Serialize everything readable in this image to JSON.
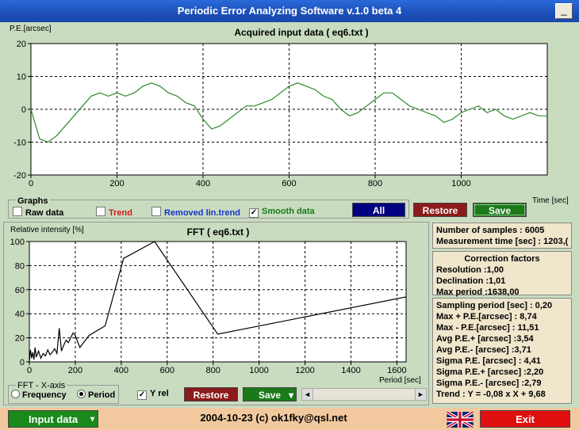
{
  "window": {
    "title": "Periodic Error Analyzing Software v.1.0 beta 4",
    "minimize_glyph": "_"
  },
  "top_chart": {
    "title": "Acquired input data ( eq6.txt )",
    "ylabel": "P.E.[arcsec]",
    "xlabel": "Time [sec]",
    "x_ticks": [
      "0",
      "200",
      "400",
      "600",
      "800",
      "1000"
    ],
    "y_ticks": [
      "20",
      "10",
      "0",
      "-10",
      "-20"
    ]
  },
  "graphs": {
    "legend": "Graphs",
    "raw": "Raw data",
    "trend": "Trend",
    "removed": "Removed lin.trend",
    "smooth": "Smooth data",
    "check_glyph": "✓",
    "all_btn": "All",
    "restore_btn": "Restore",
    "save_btn": "Save"
  },
  "fft_chart": {
    "title": "FFT ( eq6.txt )",
    "ylabel": "Relative intensity [%]",
    "xlabel": "Period [sec]",
    "x_ticks": [
      "0",
      "200",
      "400",
      "600",
      "800",
      "1000",
      "1200",
      "1400",
      "1600"
    ],
    "y_ticks": [
      "100",
      "80",
      "60",
      "40",
      "20",
      "0"
    ]
  },
  "fft_controls": {
    "legend": "FFT - X-axis",
    "frequency": "Frequency",
    "period": "Period",
    "yrel": "Y rel",
    "check_glyph": "✓",
    "restore_btn": "Restore",
    "save_btn": "Save",
    "scroll_left": "◄",
    "scroll_right": "►",
    "dropdown": "▾"
  },
  "info_samples": {
    "line1": "Number of samples : 6005",
    "line2": "Measurement time [sec] : 1203,("
  },
  "correction": {
    "title": "Correction factors",
    "resolution": "Resolution :1,00",
    "declination": "Declination :1,01",
    "max_period": "Max period :1638,00"
  },
  "stats": [
    "Sampling period [sec] : 0,20",
    "Max + P.E.[arcsec] : 8,74",
    "Max - P.E.[arcsec] : 11,51",
    "Avg P.E.+ [arcsec] :3,54",
    "Avg P.E.- [arcsec] :3,71",
    "Sigma P.E. [arcsec] : 4,41",
    "Sigma P.E.+ [arcsec] :2,20",
    "Sigma P.E.- [arcsec] :2,79",
    "Trend : Y = -0,08 x X + 9,68"
  ],
  "bottom": {
    "input_btn": "Input data",
    "dropdown": "▾",
    "footer": "2004-10-23 (c) ok1fky@qsl.net",
    "exit_btn": "Exit"
  },
  "colors": {
    "smooth": "#2a8a2a",
    "all_btn": "#000080",
    "restore_btn": "#8b1a1a",
    "save_btn": "#1a7a1a",
    "exit_btn": "#e01010"
  },
  "chart_data": [
    {
      "type": "line",
      "title": "Acquired input data ( eq6.txt )",
      "xlabel": "Time [sec]",
      "ylabel": "P.E.[arcsec]",
      "xlim": [
        0,
        1200
      ],
      "ylim": [
        -20,
        20
      ],
      "grid": true,
      "series": [
        {
          "name": "Smooth data",
          "x": [
            0,
            20,
            40,
            60,
            80,
            100,
            120,
            140,
            160,
            180,
            200,
            220,
            240,
            260,
            280,
            300,
            320,
            340,
            360,
            380,
            400,
            420,
            440,
            460,
            480,
            500,
            520,
            540,
            560,
            580,
            600,
            620,
            640,
            660,
            680,
            700,
            720,
            740,
            760,
            780,
            800,
            820,
            840,
            860,
            880,
            900,
            920,
            940,
            960,
            980,
            1000,
            1020,
            1040,
            1060,
            1080,
            1100,
            1120,
            1140,
            1160,
            1180,
            1200
          ],
          "y": [
            0,
            -9,
            -10,
            -8,
            -5,
            -2,
            1,
            4,
            5,
            4,
            5,
            4,
            5,
            7,
            8,
            7,
            5,
            4,
            2,
            1,
            -3,
            -6,
            -5,
            -3,
            -1,
            1,
            1,
            2,
            3,
            5,
            7,
            8,
            7,
            6,
            4,
            3,
            0,
            -2,
            -1,
            1,
            3,
            5,
            5,
            3,
            1,
            0,
            -1,
            -2,
            -4,
            -3,
            -1,
            0,
            1,
            -1,
            0,
            -2,
            -3,
            -2,
            -1,
            -2,
            -2
          ]
        }
      ]
    },
    {
      "type": "line",
      "title": "FFT ( eq6.txt )",
      "xlabel": "Period [sec]",
      "ylabel": "Relative intensity [%]",
      "xlim": [
        0,
        1640
      ],
      "ylim": [
        0,
        100
      ],
      "grid": true,
      "series": [
        {
          "name": "FFT",
          "x": [
            0,
            5,
            10,
            15,
            20,
            25,
            30,
            40,
            50,
            60,
            70,
            80,
            90,
            100,
            110,
            120,
            130,
            140,
            150,
            160,
            170,
            180,
            190,
            200,
            220,
            260,
            330,
            410,
            545,
            820,
            1640
          ],
          "y": [
            0,
            10,
            3,
            8,
            2,
            12,
            4,
            9,
            3,
            7,
            5,
            10,
            6,
            8,
            11,
            7,
            28,
            9,
            14,
            18,
            16,
            20,
            24,
            22,
            12,
            22,
            30,
            86,
            100,
            23,
            54
          ]
        }
      ]
    }
  ]
}
